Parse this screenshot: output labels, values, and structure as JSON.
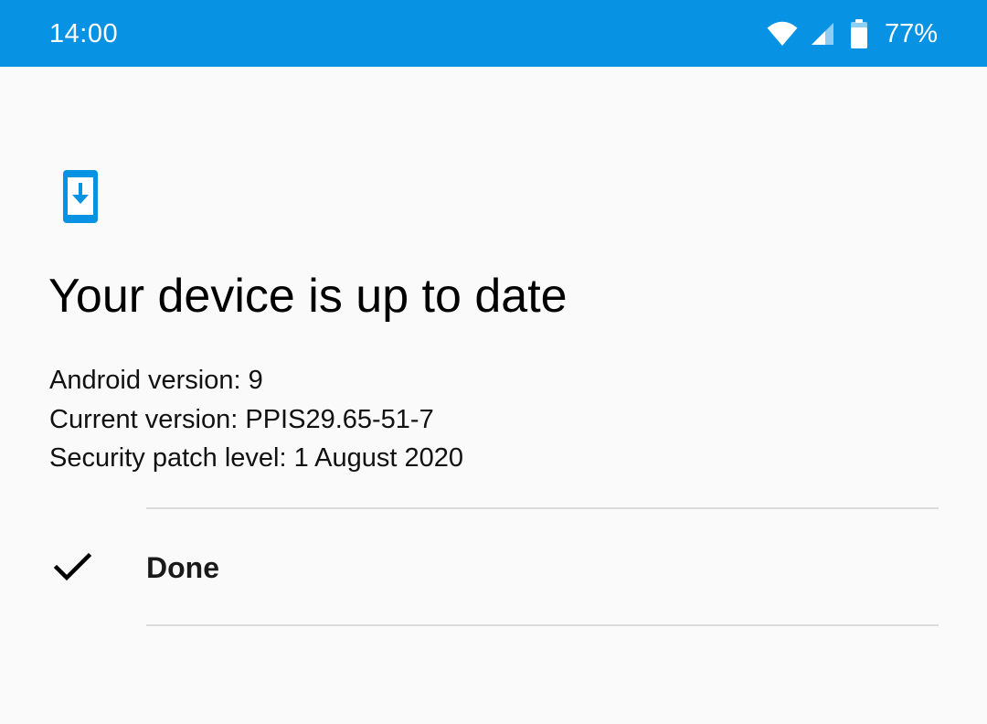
{
  "status_bar": {
    "time": "14:00",
    "battery": "77%",
    "background_color": "#0892e3",
    "icons": [
      "wifi-icon",
      "cellular-signal-icon",
      "battery-icon"
    ]
  },
  "header": {
    "icon": "system-update-icon",
    "icon_color": "#0892e3",
    "title": "Your device is up to date"
  },
  "info": {
    "android_version": "Android version: 9",
    "current_version": "Current version: PPIS29.65-51-7",
    "security_patch": "Security patch level: 1 August 2020"
  },
  "actions": {
    "done_icon": "check-icon",
    "done_label": "Done"
  }
}
